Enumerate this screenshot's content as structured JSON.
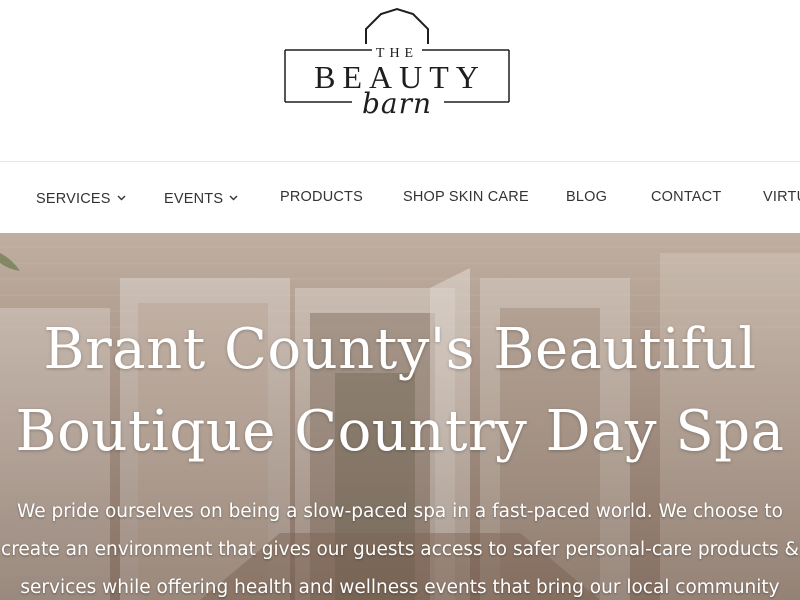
{
  "logo": {
    "the": "THE",
    "beauty": "BEAUTY",
    "barn": "barn"
  },
  "nav": {
    "items": [
      {
        "label": "SERVICES",
        "has_dropdown": true
      },
      {
        "label": "EVENTS",
        "has_dropdown": true
      },
      {
        "label": "PRODUCTS",
        "has_dropdown": false
      },
      {
        "label": "SHOP SKIN CARE",
        "has_dropdown": false
      },
      {
        "label": "BLOG",
        "has_dropdown": false
      },
      {
        "label": "CONTACT",
        "has_dropdown": false
      },
      {
        "label": "VIRTU",
        "has_dropdown": false
      }
    ],
    "dropdown_icon": "chevron-down-icon"
  },
  "hero": {
    "title_lines": [
      "Brant County's Beautiful",
      "Boutique Country Day Spa"
    ],
    "text_lines": [
      "We pride ourselves on being a slow-paced spa in a fast-paced world. We choose to",
      "create an environment that gives our guests access to safer personal-care products &",
      "services while offering health and wellness events that bring our local community"
    ]
  },
  "colors": {
    "nav_text": "#333333",
    "hero_text": "#ffffff",
    "logo_ink": "#1e1e1e",
    "divider": "#e6e6e6"
  }
}
